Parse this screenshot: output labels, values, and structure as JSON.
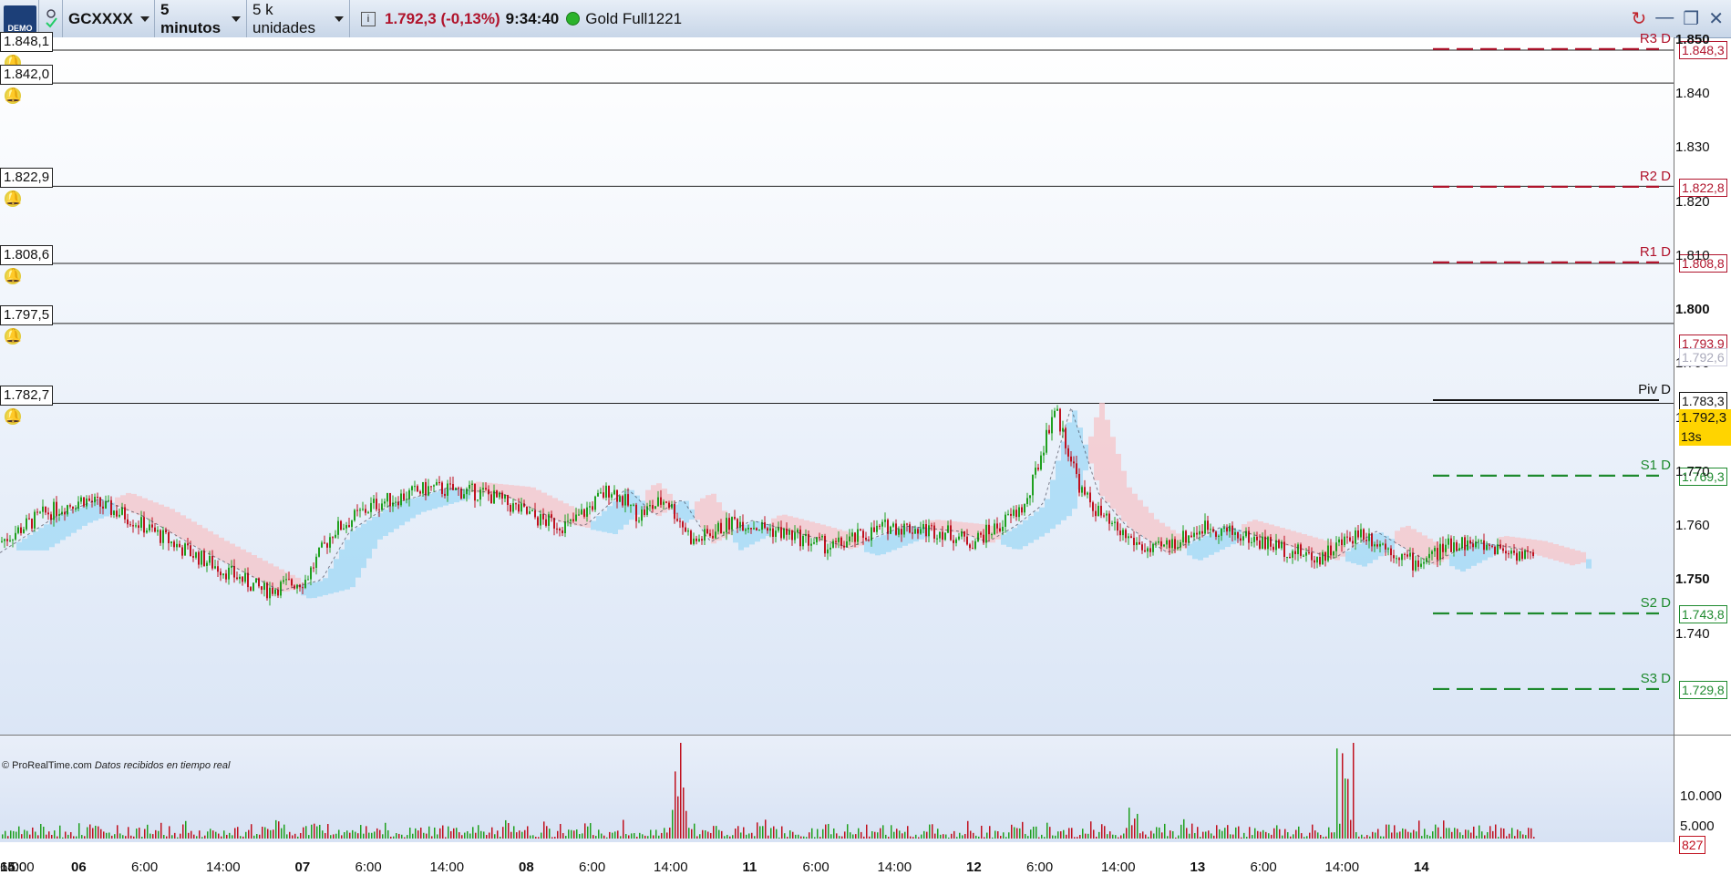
{
  "toolbar": {
    "demo_logo": "DEMO",
    "instrument": "GCXXXX",
    "timeframe": "5 minutos",
    "units": "5 k unidades",
    "price": "1.792,3 (-0,13%)",
    "time": "9:34:40",
    "contract": "Gold Full1221",
    "window_controls": [
      "↻",
      "—",
      "❐",
      "✕"
    ]
  },
  "alert_levels": [
    {
      "label": "1.848,1",
      "value": 1848.1
    },
    {
      "label": "1.842,0",
      "value": 1842.0
    },
    {
      "label": "1.822,9",
      "value": 1822.9
    },
    {
      "label": "1.808,6",
      "value": 1808.6
    },
    {
      "label": "1.797,5",
      "value": 1797.5
    },
    {
      "label": "1.782,7",
      "value": 1782.7
    }
  ],
  "pivots": [
    {
      "name": "R3 D",
      "tag": "1.848,3",
      "value": 1848.3,
      "color": "#b0132b"
    },
    {
      "name": "R2 D",
      "tag": "1.822,8",
      "value": 1822.8,
      "color": "#b0132b"
    },
    {
      "name": "R1 D",
      "tag": "1.808,8",
      "value": 1808.8,
      "color": "#b0132b"
    },
    {
      "name": "Piv D",
      "tag": "1.783,3",
      "value": 1783.3,
      "color": "#111111"
    },
    {
      "name": "S1 D",
      "tag": "1.769,3",
      "value": 1769.3,
      "color": "#1e8a2e"
    },
    {
      "name": "S2 D",
      "tag": "1.743,8",
      "value": 1743.8,
      "color": "#1e8a2e"
    },
    {
      "name": "S3 D",
      "tag": "1.729,8",
      "value": 1729.8,
      "color": "#1e8a2e"
    }
  ],
  "price_axis": [
    {
      "label": "1.850",
      "value": 1850,
      "bold": true
    },
    {
      "label": "1.840",
      "value": 1840
    },
    {
      "label": "1.830",
      "value": 1830
    },
    {
      "label": "1.820",
      "value": 1820
    },
    {
      "label": "1.810",
      "value": 1810
    },
    {
      "label": "1.800",
      "value": 1800,
      "bold": true
    },
    {
      "label": "1.790",
      "value": 1790
    },
    {
      "label": "1.780",
      "value": 1780
    },
    {
      "label": "1.770",
      "value": 1770
    },
    {
      "label": "1.760",
      "value": 1760
    },
    {
      "label": "1.750",
      "value": 1750,
      "bold": true
    },
    {
      "label": "1.740",
      "value": 1740
    }
  ],
  "price_tags": {
    "high": "1.793,9",
    "ichimoku": "1.792,6",
    "current": "1.792,3",
    "countdown": "13s"
  },
  "time_axis": [
    {
      "label": "06",
      "day": true
    },
    {
      "label": "6:00"
    },
    {
      "label": "14:00"
    },
    {
      "label": "07",
      "day": true
    },
    {
      "label": "6:00"
    },
    {
      "label": "14:00"
    },
    {
      "label": "08",
      "day": true
    },
    {
      "label": "6:00"
    },
    {
      "label": "14:00"
    },
    {
      "label": "11",
      "day": true
    },
    {
      "label": "6:00"
    },
    {
      "label": "14:00"
    },
    {
      "label": "12",
      "day": true
    },
    {
      "label": "6:00"
    },
    {
      "label": "14:00"
    },
    {
      "label": "13",
      "day": true
    },
    {
      "label": "6:00"
    },
    {
      "label": "14:00"
    },
    {
      "label": "14",
      "day": true
    },
    {
      "label": "6:00"
    },
    {
      "label": "14:00"
    },
    {
      "label": "15",
      "day": true
    }
  ],
  "volume_axis": [
    {
      "label": "10.000",
      "value": 10000
    },
    {
      "label": "5.000",
      "value": 5000
    }
  ],
  "volume_current": "827",
  "copyright": "© ProRealTime.com",
  "realtime_note": "Datos recibidos en tiempo real",
  "colors": {
    "up": "#1fa01f",
    "down": "#c0111f",
    "cloud_blue": "#9fd8f5",
    "cloud_red": "#f6c4c8"
  },
  "chart_data": {
    "type": "line",
    "series": [],
    "x": [
      "06",
      "6:00",
      "14:00",
      "07",
      "6:00",
      "14:00",
      "08",
      "6:00",
      "14:00",
      "11",
      "6:00",
      "14:00",
      "12",
      "6:00",
      "14:00",
      "13",
      "6:00",
      "14:00",
      "14",
      "6:00",
      "14:00",
      "15"
    ],
    "price_path": [
      [
        0,
        1757
      ],
      [
        0.03,
        1762
      ],
      [
        0.06,
        1765
      ],
      [
        0.09,
        1762
      ],
      [
        0.13,
        1756
      ],
      [
        0.16,
        1752
      ],
      [
        0.19,
        1748
      ],
      [
        0.22,
        1750
      ],
      [
        0.24,
        1759
      ],
      [
        0.27,
        1764
      ],
      [
        0.31,
        1767
      ],
      [
        0.35,
        1766
      ],
      [
        0.39,
        1761
      ],
      [
        0.41,
        1760
      ],
      [
        0.44,
        1767
      ],
      [
        0.46,
        1762
      ],
      [
        0.48,
        1765
      ],
      [
        0.5,
        1757
      ],
      [
        0.53,
        1761
      ],
      [
        0.56,
        1759
      ],
      [
        0.6,
        1756
      ],
      [
        0.64,
        1760
      ],
      [
        0.68,
        1759
      ],
      [
        0.7,
        1757
      ],
      [
        0.72,
        1760
      ],
      [
        0.74,
        1764
      ],
      [
        0.76,
        1782
      ],
      [
        0.78,
        1766
      ],
      [
        0.8,
        1760
      ],
      [
        0.83,
        1755
      ],
      [
        0.87,
        1760
      ],
      [
        0.91,
        1757
      ],
      [
        0.95,
        1754
      ],
      [
        0.98,
        1759
      ],
      [
        1.02,
        1753
      ],
      [
        1.05,
        1757
      ],
      [
        1.08,
        1756
      ],
      [
        1.12,
        1753
      ],
      [
        1.16,
        1756
      ],
      [
        1.2,
        1763
      ],
      [
        1.23,
        1761
      ],
      [
        1.26,
        1766
      ],
      [
        1.29,
        1769
      ],
      [
        1.31,
        1762
      ],
      [
        1.33,
        1761
      ],
      [
        1.36,
        1762
      ],
      [
        1.4,
        1761
      ],
      [
        1.44,
        1762
      ],
      [
        1.48,
        1764
      ],
      [
        1.5,
        1767
      ],
      [
        1.52,
        1770
      ],
      [
        1.54,
        1778
      ],
      [
        1.56,
        1760
      ],
      [
        1.58,
        1778
      ],
      [
        1.6,
        1796
      ],
      [
        1.63,
        1794
      ],
      [
        1.67,
        1793
      ],
      [
        1.71,
        1792
      ],
      [
        1.74,
        1790
      ],
      [
        1.76,
        1789
      ],
      [
        1.78,
        1791
      ],
      [
        1.8,
        1794
      ],
      [
        1.82,
        1792
      ]
    ],
    "ylim": [
      1727,
      1852
    ]
  }
}
